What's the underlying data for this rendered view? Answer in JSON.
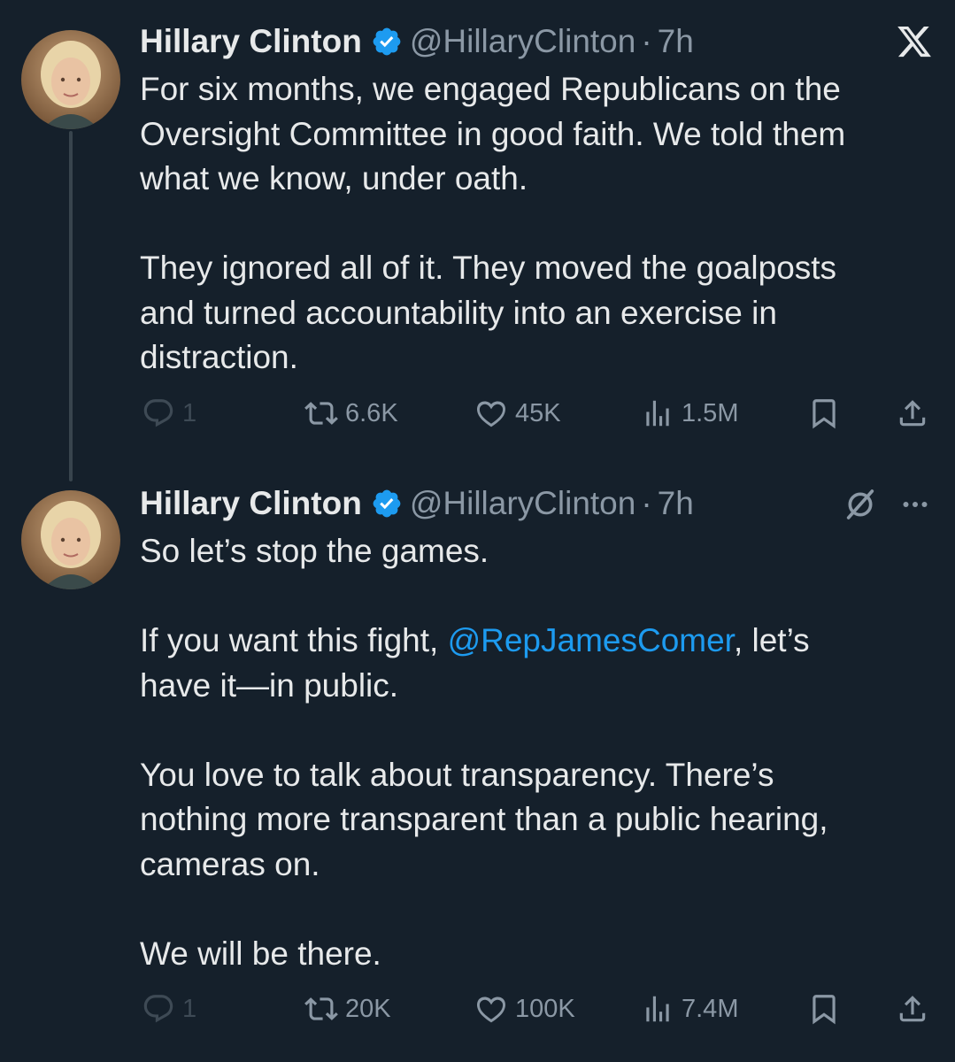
{
  "tweets": [
    {
      "author": {
        "name": "Hillary Clinton",
        "handle": "@HillaryClinton",
        "verified": true
      },
      "separator": "·",
      "time": "7h",
      "paragraphs": [
        [
          "For six months, we engaged Republicans on the",
          "Oversight Committee in good faith. We told them",
          "what we know, under oath."
        ],
        [
          "They ignored all of it. They moved the goalposts",
          "and turned accountability into an exercise in",
          "distraction."
        ]
      ],
      "stats": {
        "replies": "1",
        "reposts": "6.6K",
        "likes": "45K",
        "views": "1.5M"
      }
    },
    {
      "author": {
        "name": "Hillary Clinton",
        "handle": "@HillaryClinton",
        "verified": true
      },
      "separator": "·",
      "time": "7h",
      "p1": "So let’s stop the games.",
      "p2": {
        "before": "If you want this fight, ",
        "mention": "@RepJamesComer",
        "after": ", let’s",
        "line2": "have it—in public."
      },
      "p3": [
        "You love to talk about transparency. There’s",
        "nothing more transparent than a public hearing,",
        "cameras on."
      ],
      "p4": "We will be there.",
      "stats": {
        "replies": "1",
        "reposts": "20K",
        "likes": "100K",
        "views": "7.4M"
      }
    }
  ],
  "icons": {
    "top_right": "x-logo-icon",
    "post_menu": [
      "grok-icon",
      "more-icon"
    ],
    "actions": [
      "reply-icon",
      "repost-icon",
      "like-icon",
      "views-icon",
      "bookmark-icon",
      "share-icon"
    ]
  },
  "colors": {
    "background": "#15202b",
    "text": "#e7e9ea",
    "secondary": "#8b98a5",
    "link": "#1d9bf0",
    "verified": "#1d9bf0"
  }
}
